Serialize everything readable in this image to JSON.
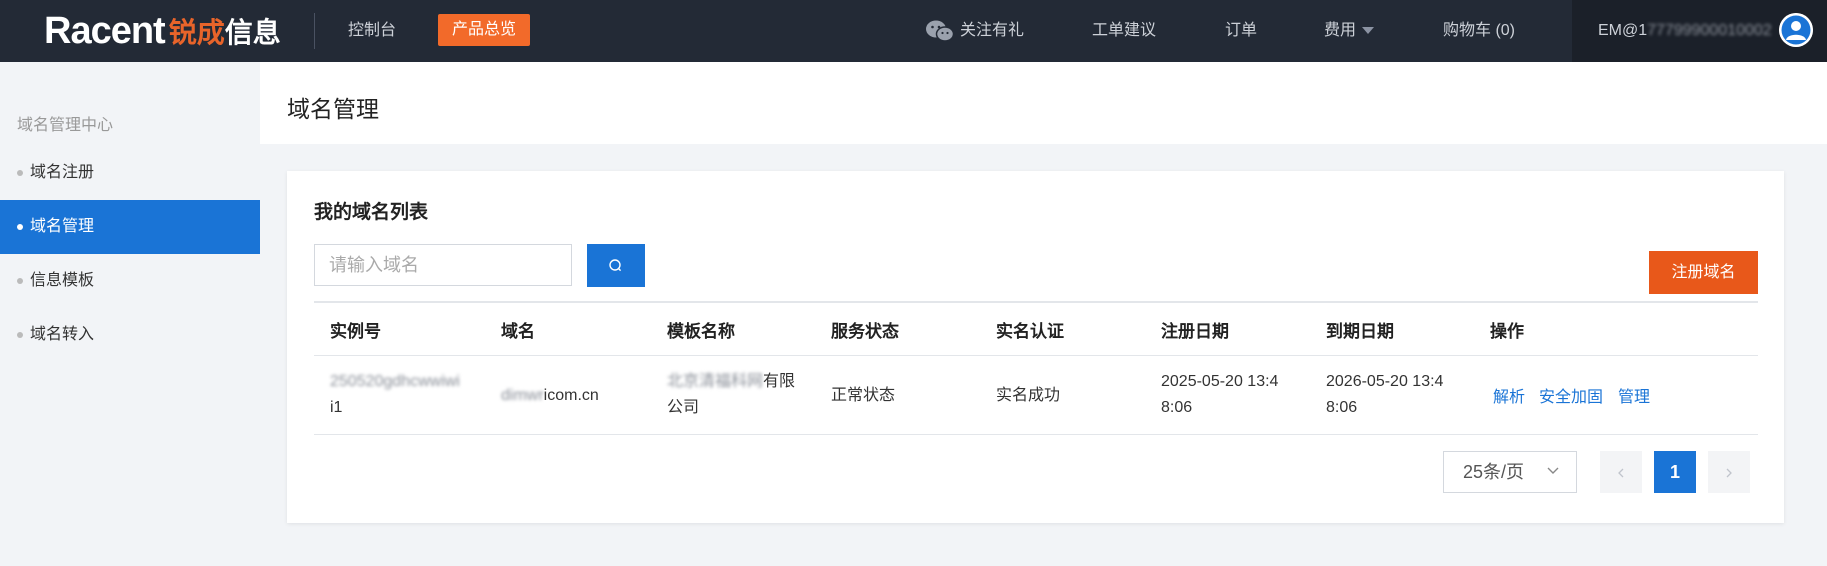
{
  "header": {
    "logo_en": "Racent",
    "logo_cn_1": "锐成",
    "logo_cn_2": "信息",
    "console": "控制台",
    "products": "产品总览",
    "wechat": "关注有礼",
    "ticket": "工单建议",
    "orders": "订单",
    "fees": "费用",
    "cart": "购物车 (0)",
    "account_prefix": "EM@1",
    "account_redacted": "77799900010002"
  },
  "sidebar": {
    "header": "域名管理中心",
    "items": [
      {
        "label": "域名注册",
        "active": false
      },
      {
        "label": "域名管理",
        "active": true
      },
      {
        "label": "信息模板",
        "active": false
      },
      {
        "label": "域名转入",
        "active": false
      }
    ]
  },
  "main": {
    "title": "域名管理",
    "card_title": "我的域名列表",
    "search_placeholder": "请输入域名",
    "register_button": "注册域名"
  },
  "table": {
    "headers": [
      "实例号",
      "域名",
      "模板名称",
      "服务状态",
      "实名认证",
      "注册日期",
      "到期日期",
      "操作"
    ],
    "rows": [
      {
        "instance_redacted": "250520gdhcwwiwi",
        "instance_tail": "i1",
        "domain_redacted": "dimwr",
        "domain_tail": "icom.cn",
        "template_redacted": "北京清福科网",
        "template_tail": "有限",
        "template_line2": "公司",
        "status": "正常状态",
        "realname": "实名成功",
        "reg_date_1": "2025-05-20 13:4",
        "reg_date_2": "8:06",
        "exp_date_1": "2026-05-20 13:4",
        "exp_date_2": "8:06",
        "actions": [
          "解析",
          "安全加固",
          "管理"
        ]
      }
    ]
  },
  "pagination": {
    "page_size": "25条/页",
    "current_page": "1"
  }
}
